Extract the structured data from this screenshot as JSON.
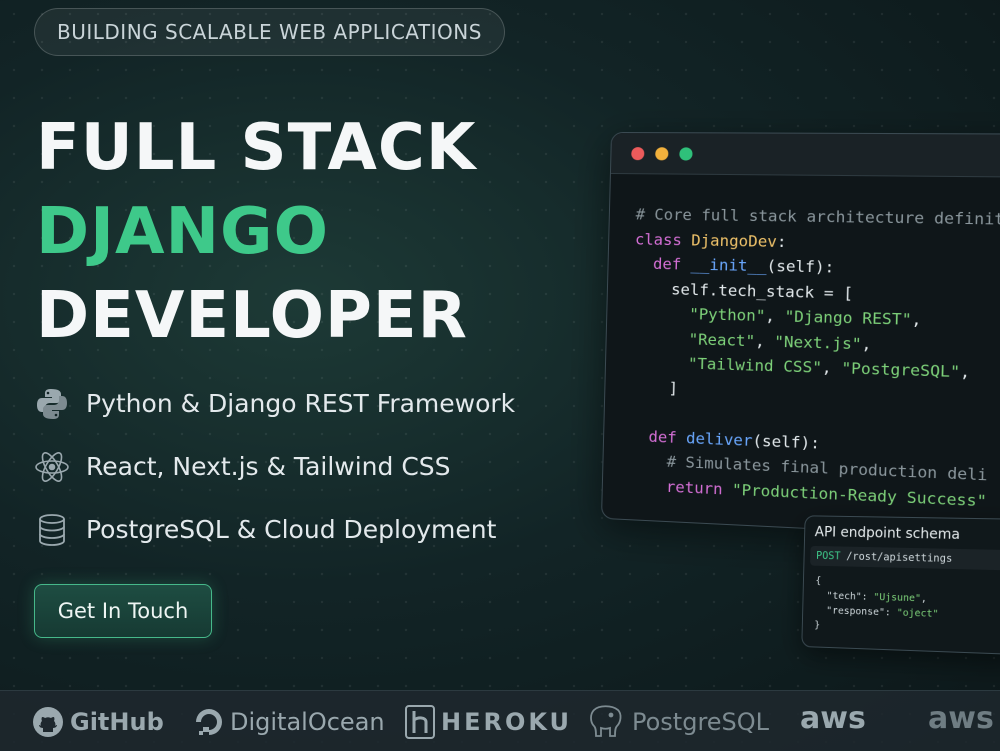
{
  "badge": "BUILDING SCALABLE WEB APPLICATIONS",
  "title": {
    "line1": "FULL STACK",
    "line2": "DJANGO",
    "line3": "DEVELOPER"
  },
  "features": [
    {
      "icon": "python-icon",
      "text": "Python & Django REST Framework"
    },
    {
      "icon": "react-icon",
      "text": "React, Next.js & Tailwind CSS"
    },
    {
      "icon": "database-icon",
      "text": "PostgreSQL & Cloud Deployment"
    }
  ],
  "cta_label": "Get In Touch",
  "code": {
    "comment1": "# Core full stack architecture definit",
    "kw_class": "class",
    "class_name": "DjangoDev",
    "colon": ":",
    "kw_def": "def",
    "init": "__init__",
    "init_args": "(self):",
    "stack_assign": "self.tech_stack = [",
    "s_python": "\"Python\"",
    "s_drf": "\"Django REST\"",
    "s_react": "\"React\"",
    "s_next": "\"Next.js\"",
    "s_tailwind": "\"Tailwind CSS\"",
    "s_pg": "\"PostgreSQL\"",
    "comma": ",",
    "close_bracket": "]",
    "deliver": "deliver",
    "deliver_args": "(self):",
    "comment2": "# Simulates final production deli",
    "kw_return": "return",
    "s_result": "\"Production-Ready Success\""
  },
  "schema": {
    "title": "API endpoint schema",
    "method": "POST",
    "path": "/rost/apisettings",
    "open_brace": "{",
    "key_tech": "\"tech\"",
    "val_tech": "\"Ujsune\"",
    "key_response": "\"response\"",
    "val_response": "\"oject\"",
    "close_brace": "}"
  },
  "logos": [
    "GitHub",
    "DigitalOcean",
    "HEROKU",
    "PostgreSQL",
    "aws",
    "aws"
  ],
  "colors": {
    "accent": "#3ec98a",
    "dot_red": "#ec5b5b",
    "dot_yellow": "#f2b13c",
    "dot_green": "#2fc07a"
  }
}
